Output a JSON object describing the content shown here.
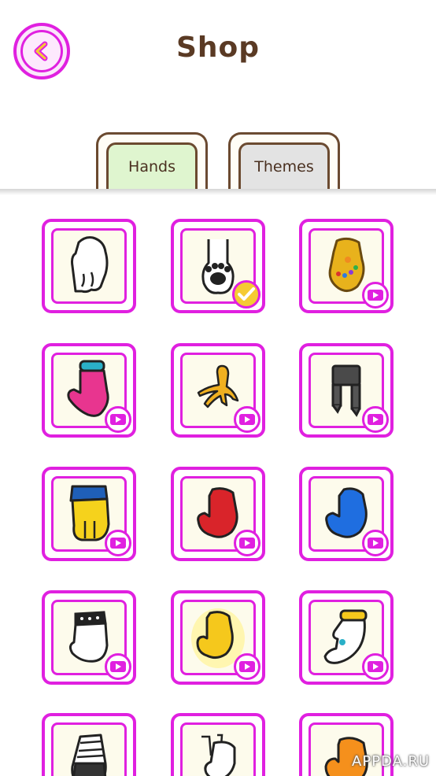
{
  "header": {
    "title": "Shop",
    "back_icon": "chevron-left-icon"
  },
  "tabs": [
    {
      "label": "Hands",
      "selected": true
    },
    {
      "label": "Themes",
      "selected": false
    }
  ],
  "colors": {
    "accent": "#e020e0",
    "title": "#5a3a24",
    "tab_selected_bg": "#dff5cf",
    "tab_bg": "#e3e3e3",
    "card_bg": "#fdfbec",
    "equipped_badge": "#f5cb33"
  },
  "items": [
    {
      "icon": "white-glove-icon",
      "badge": "none"
    },
    {
      "icon": "cat-paw-icon",
      "badge": "equipped-check-icon"
    },
    {
      "icon": "golden-gauntlet-icon",
      "badge": "video-ad-icon"
    },
    {
      "icon": "pink-glove-icon",
      "badge": "video-ad-icon"
    },
    {
      "icon": "bird-claw-icon",
      "badge": "video-ad-icon"
    },
    {
      "icon": "robot-claw-icon",
      "badge": "video-ad-icon"
    },
    {
      "icon": "yellow-mitten-icon",
      "badge": "video-ad-icon"
    },
    {
      "icon": "red-glove-icon",
      "badge": "video-ad-icon"
    },
    {
      "icon": "blue-glove-icon",
      "badge": "video-ad-icon"
    },
    {
      "icon": "spiked-glove-icon",
      "badge": "video-ad-icon"
    },
    {
      "icon": "glowing-gold-glove-icon",
      "badge": "video-ad-icon"
    },
    {
      "icon": "glove-with-gold-cuff-icon",
      "badge": "video-ad-icon"
    },
    {
      "icon": "bandaged-black-hand-icon",
      "badge": "none"
    },
    {
      "icon": "puppet-hand-icon",
      "badge": "none"
    },
    {
      "icon": "orange-glove-icon",
      "badge": "none"
    }
  ],
  "watermark": "APPDA.RU"
}
